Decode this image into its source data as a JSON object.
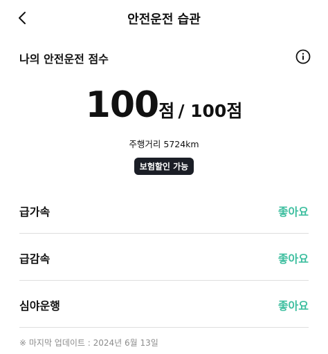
{
  "header": {
    "title": "안전운전 습관",
    "back_icon": "chevron-left-icon"
  },
  "score_section": {
    "title": "나의 안전운전 점수",
    "info_icon": "info-circle-icon",
    "score": "100",
    "score_unit": "점",
    "score_total": "/ 100점",
    "distance": "주행거리 5724km",
    "badge": "보험할인 가능"
  },
  "habits": [
    {
      "label": "급가속",
      "status": "좋아요"
    },
    {
      "label": "급감속",
      "status": "좋아요"
    },
    {
      "label": "심야운행",
      "status": "좋아요"
    }
  ],
  "footnote": "※ 마지막 업데이트 : 2024년 6월 13일",
  "colors": {
    "accent_good": "#3fbfa0",
    "badge_bg": "#1b1e26",
    "text": "#111111",
    "muted": "#8c8c8c"
  }
}
